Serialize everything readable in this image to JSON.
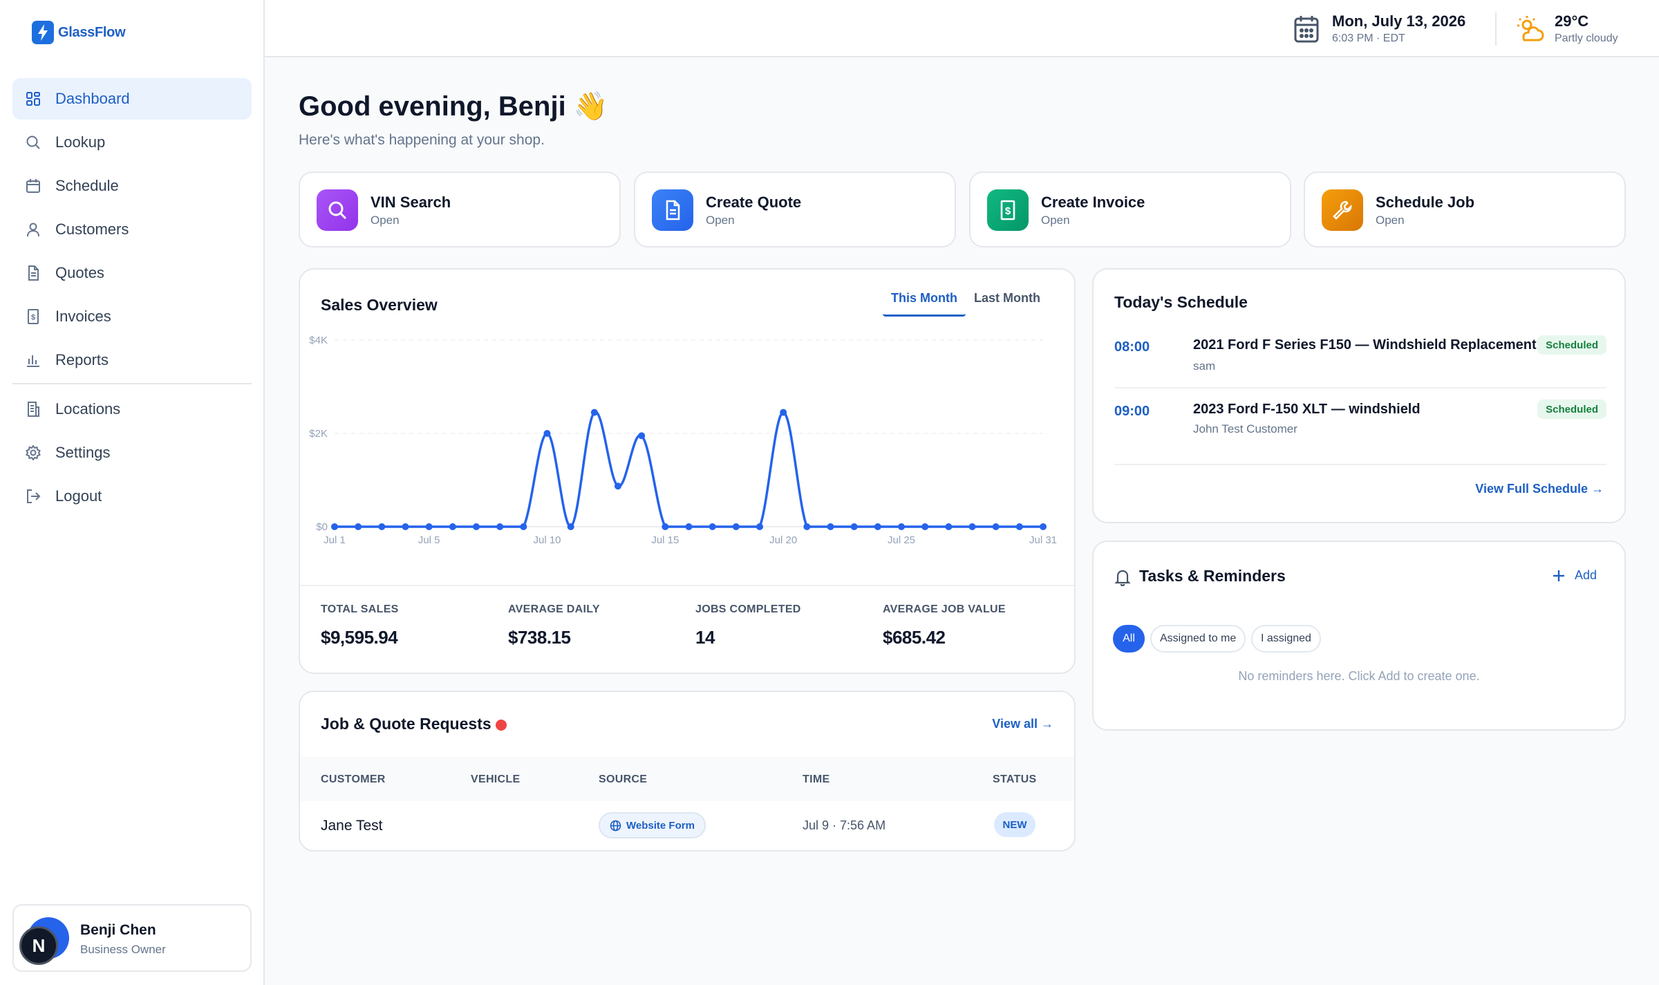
{
  "app": {
    "name": "GlassFlow"
  },
  "nav": {
    "items": [
      {
        "label": "Dashboard",
        "icon": "dashboard-icon",
        "active": true
      },
      {
        "label": "Lookup",
        "icon": "search-icon"
      },
      {
        "label": "Schedule",
        "icon": "calendar-icon"
      },
      {
        "label": "Customers",
        "icon": "user-icon"
      },
      {
        "label": "Quotes",
        "icon": "document-icon"
      },
      {
        "label": "Invoices",
        "icon": "receipt-icon"
      },
      {
        "label": "Reports",
        "icon": "bar-chart-icon"
      },
      {
        "label": "Locations",
        "icon": "building-icon"
      },
      {
        "label": "Settings",
        "icon": "gear-icon"
      },
      {
        "label": "Logout",
        "icon": "logout-icon"
      }
    ]
  },
  "user": {
    "name": "Benji Chen",
    "role": "Business Owner",
    "badge": "N"
  },
  "header": {
    "date": "Mon, July 13, 2026",
    "time": "6:03 PM · EDT",
    "temp": "29°C",
    "condition": "Partly cloudy"
  },
  "greeting": {
    "title": "Good evening, Benji 👋",
    "subtitle": "Here's what's happening at your shop."
  },
  "quick_actions": [
    {
      "title": "VIN Search",
      "sub": "Open",
      "color": "#9333ea",
      "icon": "search-icon"
    },
    {
      "title": "Create Quote",
      "sub": "Open",
      "color": "#2563eb",
      "icon": "document-icon"
    },
    {
      "title": "Create Invoice",
      "sub": "Open",
      "color": "#059669",
      "icon": "receipt-icon"
    },
    {
      "title": "Schedule Job",
      "sub": "Open",
      "color": "#d97706",
      "icon": "wrench-icon"
    }
  ],
  "sales": {
    "title": "Sales Overview",
    "tabs": [
      "This Month",
      "Last Month"
    ],
    "active_tab": "This Month",
    "stats": [
      {
        "label": "TOTAL SALES",
        "value": "$9,595.94"
      },
      {
        "label": "AVERAGE DAILY",
        "value": "$738.15"
      },
      {
        "label": "JOBS COMPLETED",
        "value": "14"
      },
      {
        "label": "AVERAGE JOB VALUE",
        "value": "$685.42"
      }
    ]
  },
  "chart_data": {
    "type": "line",
    "title": "",
    "xlabel": "",
    "ylabel": "",
    "x": [
      1,
      2,
      3,
      4,
      5,
      6,
      7,
      8,
      9,
      10,
      11,
      12,
      13,
      14,
      15,
      16,
      17,
      18,
      19,
      20,
      21,
      22,
      23,
      24,
      25,
      26,
      27,
      28,
      29,
      30,
      31
    ],
    "series": [
      {
        "values": [
          0,
          0,
          0,
          0,
          0,
          0,
          0,
          0,
          0,
          2000,
          0,
          2450,
          870,
          1950,
          0,
          0,
          0,
          0,
          0,
          2450,
          0,
          0,
          0,
          0,
          0,
          0,
          0,
          0,
          0,
          0,
          0
        ]
      }
    ],
    "x_ticks": [
      {
        "x": 1,
        "label": "Jul 1"
      },
      {
        "x": 5,
        "label": "Jul 5"
      },
      {
        "x": 10,
        "label": "Jul 10"
      },
      {
        "x": 15,
        "label": "Jul 15"
      },
      {
        "x": 20,
        "label": "Jul 20"
      },
      {
        "x": 25,
        "label": "Jul 25"
      },
      {
        "x": 31,
        "label": "Jul 31"
      }
    ],
    "y_ticks": [
      {
        "y": 0,
        "label": "$0"
      },
      {
        "y": 2000,
        "label": "$2K"
      },
      {
        "y": 4000,
        "label": "$4K"
      }
    ],
    "ylim": [
      0,
      4000
    ],
    "xlim": [
      1,
      31
    ],
    "grid": true,
    "color": "#2563eb"
  },
  "requests": {
    "title": "Job & Quote Requests",
    "view_all": "View all →",
    "columns": [
      "CUSTOMER",
      "VEHICLE",
      "SOURCE",
      "TIME",
      "STATUS"
    ],
    "rows": [
      {
        "customer": "Jane Test",
        "vehicle": "",
        "source": "Website Form",
        "time": "Jul 9 · 7:56 AM",
        "status": "NEW"
      }
    ]
  },
  "schedule": {
    "title": "Today's Schedule",
    "items": [
      {
        "time": "08:00",
        "title": "2021 Ford F Series F150 — Windshield Replacement",
        "customer": "sam",
        "status": "Scheduled"
      },
      {
        "time": "09:00",
        "title": "2023 Ford F-150 XLT — windshield",
        "customer": "John Test Customer",
        "status": "Scheduled"
      }
    ],
    "view_full": "View Full Schedule →"
  },
  "tasks": {
    "title": "Tasks & Reminders",
    "add": "Add",
    "filters": [
      "All",
      "Assigned to me",
      "I assigned"
    ],
    "active_filter": "All",
    "empty": "No reminders here. Click Add to create one."
  }
}
